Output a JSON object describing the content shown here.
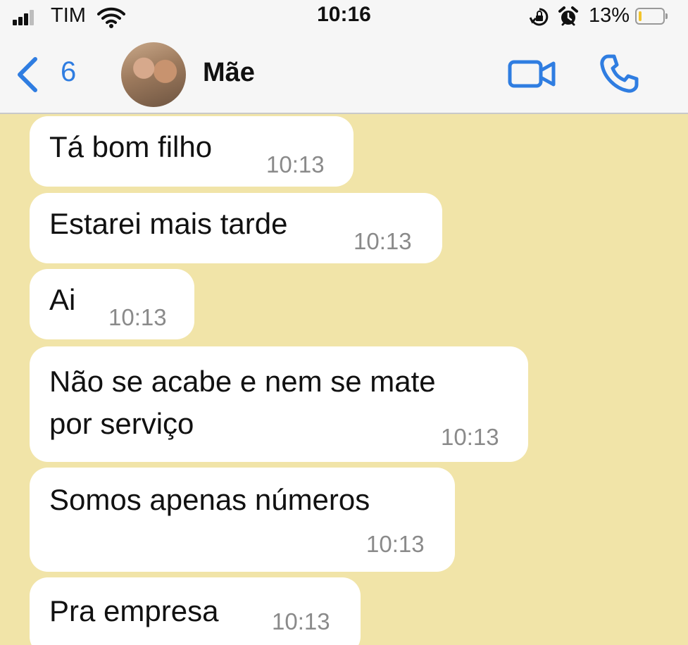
{
  "status_bar": {
    "carrier": "TIM",
    "time": "10:16",
    "battery_percent": "13%",
    "battery_level": 0.13,
    "signal_bars": 3,
    "icons": [
      "signal-icon",
      "wifi-icon",
      "orientation-lock-icon",
      "alarm-icon",
      "battery-icon"
    ]
  },
  "header": {
    "back_count": "6",
    "contact_name": "Mãe",
    "accent_color": "#2f7de1",
    "icons": [
      "back-chevron-icon",
      "video-call-icon",
      "phone-call-icon"
    ]
  },
  "chat": {
    "background_color": "#f1e4a8",
    "messages": [
      {
        "text": "Tá bom filho",
        "time": "10:13"
      },
      {
        "text": "Estarei mais tarde",
        "time": "10:13"
      },
      {
        "text": "Ai",
        "time": "10:13"
      },
      {
        "text": "Não se acabe e nem se mate\npor serviço",
        "time": "10:13"
      },
      {
        "text": "Somos apenas números",
        "time": "10:13"
      },
      {
        "text": "Pra empresa",
        "time": "10:13"
      }
    ]
  }
}
